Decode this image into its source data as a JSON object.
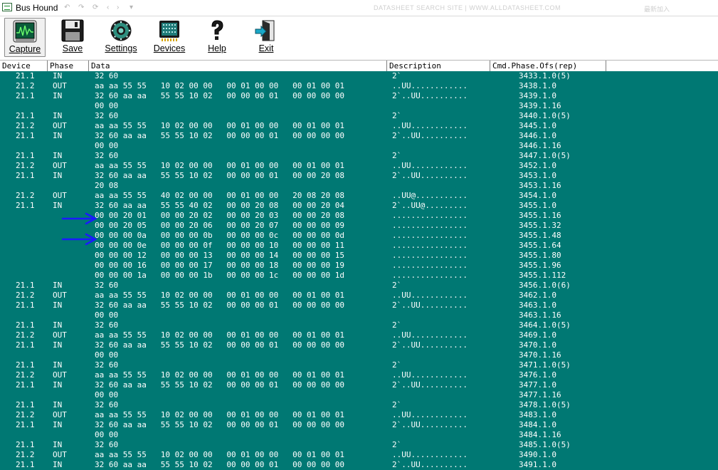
{
  "window": {
    "title": "Bus Hound",
    "faded_title": "DATASHEET SEARCH SITE | WWW.ALLDATASHEET.COM",
    "faded_tail": "最新加入"
  },
  "toolbar": {
    "buttons": [
      {
        "id": "capture",
        "label": "Capture",
        "icon": "capture-scope-icon",
        "pressed": true
      },
      {
        "id": "save",
        "label": "Save",
        "icon": "floppy-disk-icon"
      },
      {
        "id": "settings",
        "label": "Settings",
        "icon": "settings-dial-icon"
      },
      {
        "id": "devices",
        "label": "Devices",
        "icon": "devices-chip-icon"
      },
      {
        "id": "help",
        "label": "Help",
        "icon": "question-mark-icon"
      },
      {
        "id": "exit",
        "label": "Exit",
        "icon": "exit-door-icon"
      }
    ]
  },
  "columns": [
    "Device",
    "Phase",
    "Data",
    "Description",
    "Cmd.Phase.Ofs(rep)"
  ],
  "rows": [
    [
      "21.1",
      "IN",
      "32 60",
      "2`",
      "3433.1.0(5)"
    ],
    [
      "21.2",
      "OUT",
      "aa aa 55 55   10 02 00 00   00 01 00 00   00 01 00 01",
      "..UU............",
      "3438.1.0"
    ],
    [
      "21.1",
      "IN",
      "32 60 aa aa   55 55 10 02   00 00 00 01   00 00 00 00",
      "2`..UU..........",
      "3439.1.0"
    ],
    [
      "",
      "",
      "00 00",
      "",
      "3439.1.16"
    ],
    [
      "21.1",
      "IN",
      "32 60",
      "2`",
      "3440.1.0(5)"
    ],
    [
      "21.2",
      "OUT",
      "aa aa 55 55   10 02 00 00   00 01 00 00   00 01 00 01",
      "..UU............",
      "3445.1.0"
    ],
    [
      "21.1",
      "IN",
      "32 60 aa aa   55 55 10 02   00 00 00 01   00 00 00 00",
      "2`..UU..........",
      "3446.1.0"
    ],
    [
      "",
      "",
      "00 00",
      "",
      "3446.1.16"
    ],
    [
      "21.1",
      "IN",
      "32 60",
      "2`",
      "3447.1.0(5)"
    ],
    [
      "21.2",
      "OUT",
      "aa aa 55 55   10 02 00 00   00 01 00 00   00 01 00 01",
      "..UU............",
      "3452.1.0"
    ],
    [
      "21.1",
      "IN",
      "32 60 aa aa   55 55 10 02   00 00 00 01   00 00 20 08",
      "2`..UU..........",
      "3453.1.0"
    ],
    [
      "",
      "",
      "20 08",
      "",
      "3453.1.16"
    ],
    [
      "21.2",
      "OUT",
      "aa aa 55 55   40 02 00 00   00 01 00 00   20 08 20 08",
      "..UU@...........",
      "3454.1.0"
    ],
    [
      "21.1",
      "IN",
      "32 60 aa aa   55 55 40 02   00 00 20 08   00 00 20 04",
      "2`..UU@.........",
      "3455.1.0"
    ],
    [
      "",
      "",
      "00 00 20 01   00 00 20 02   00 00 20 03   00 00 20 08",
      "................",
      "3455.1.16"
    ],
    [
      "",
      "",
      "00 00 20 05   00 00 20 06   00 00 20 07   00 00 00 09",
      "................",
      "3455.1.32"
    ],
    [
      "",
      "",
      "00 00 00 0a   00 00 00 0b   00 00 00 0c   00 00 00 0d",
      "................",
      "3455.1.48"
    ],
    [
      "",
      "",
      "00 00 00 0e   00 00 00 0f   00 00 00 10   00 00 00 11",
      "................",
      "3455.1.64"
    ],
    [
      "",
      "",
      "00 00 00 12   00 00 00 13   00 00 00 14   00 00 00 15",
      "................",
      "3455.1.80"
    ],
    [
      "",
      "",
      "00 00 00 16   00 00 00 17   00 00 00 18   00 00 00 19",
      "................",
      "3455.1.96"
    ],
    [
      "",
      "",
      "00 00 00 1a   00 00 00 1b   00 00 00 1c   00 00 00 1d",
      "................",
      "3455.1.112"
    ],
    [
      "21.1",
      "IN",
      "32 60",
      "2`",
      "3456.1.0(6)"
    ],
    [
      "21.2",
      "OUT",
      "aa aa 55 55   10 02 00 00   00 01 00 00   00 01 00 01",
      "..UU............",
      "3462.1.0"
    ],
    [
      "21.1",
      "IN",
      "32 60 aa aa   55 55 10 02   00 00 00 01   00 00 00 00",
      "2`..UU..........",
      "3463.1.0"
    ],
    [
      "",
      "",
      "00 00",
      "",
      "3463.1.16"
    ],
    [
      "21.1",
      "IN",
      "32 60",
      "2`",
      "3464.1.0(5)"
    ],
    [
      "21.2",
      "OUT",
      "aa aa 55 55   10 02 00 00   00 01 00 00   00 01 00 01",
      "..UU............",
      "3469.1.0"
    ],
    [
      "21.1",
      "IN",
      "32 60 aa aa   55 55 10 02   00 00 00 01   00 00 00 00",
      "2`..UU..........",
      "3470.1.0"
    ],
    [
      "",
      "",
      "00 00",
      "",
      "3470.1.16"
    ],
    [
      "21.1",
      "IN",
      "32 60",
      "2`",
      "3471.1.0(5)"
    ],
    [
      "21.2",
      "OUT",
      "aa aa 55 55   10 02 00 00   00 01 00 00   00 01 00 01",
      "..UU............",
      "3476.1.0"
    ],
    [
      "21.1",
      "IN",
      "32 60 aa aa   55 55 10 02   00 00 00 01   00 00 00 00",
      "2`..UU..........",
      "3477.1.0"
    ],
    [
      "",
      "",
      "00 00",
      "",
      "3477.1.16"
    ],
    [
      "21.1",
      "IN",
      "32 60",
      "2`",
      "3478.1.0(5)"
    ],
    [
      "21.2",
      "OUT",
      "aa aa 55 55   10 02 00 00   00 01 00 00   00 01 00 01",
      "..UU............",
      "3483.1.0"
    ],
    [
      "21.1",
      "IN",
      "32 60 aa aa   55 55 10 02   00 00 00 01   00 00 00 00",
      "2`..UU..........",
      "3484.1.0"
    ],
    [
      "",
      "",
      "00 00",
      "",
      "3484.1.16"
    ],
    [
      "21.1",
      "IN",
      "32 60",
      "2`",
      "3485.1.0(5)"
    ],
    [
      "21.2",
      "OUT",
      "aa aa 55 55   10 02 00 00   00 01 00 00   00 01 00 01",
      "..UU............",
      "3490.1.0"
    ],
    [
      "21.1",
      "IN",
      "32 60 aa aa   55 55 10 02   00 00 00 01   00 00 00 00",
      "2`..UU..........",
      "3491.1.0"
    ]
  ],
  "colors": {
    "grid_bg": "#007873",
    "grid_text": "#ffffff",
    "arrow": "#1a1aff"
  }
}
